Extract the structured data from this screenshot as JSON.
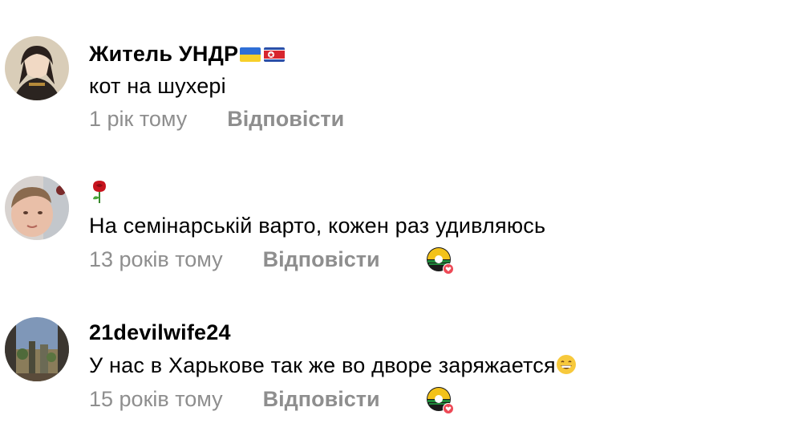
{
  "comments": [
    {
      "author": "Житель УНДР",
      "author_flags": [
        "ukraine-flag",
        "north-korea-flag"
      ],
      "text": "кот на шухері",
      "time": "1 рік тому",
      "reply_label": "Відповісти",
      "liked_by_creator": false
    },
    {
      "author": "🌹",
      "text": "На семінарській варто, кожен раз удивляюсь",
      "time": "13 років тому",
      "reply_label": "Відповісти",
      "liked_by_creator": true
    },
    {
      "author": "21devilwife24",
      "text": "У нас в Харькове так же во дворе заряжается",
      "text_emoji": "grinning-face-icon",
      "time": "15 років тому",
      "reply_label": "Відповісти",
      "liked_by_creator": true
    }
  ],
  "colors": {
    "meta_text": "#8e8e8e",
    "like_badge": "#ed4956"
  }
}
